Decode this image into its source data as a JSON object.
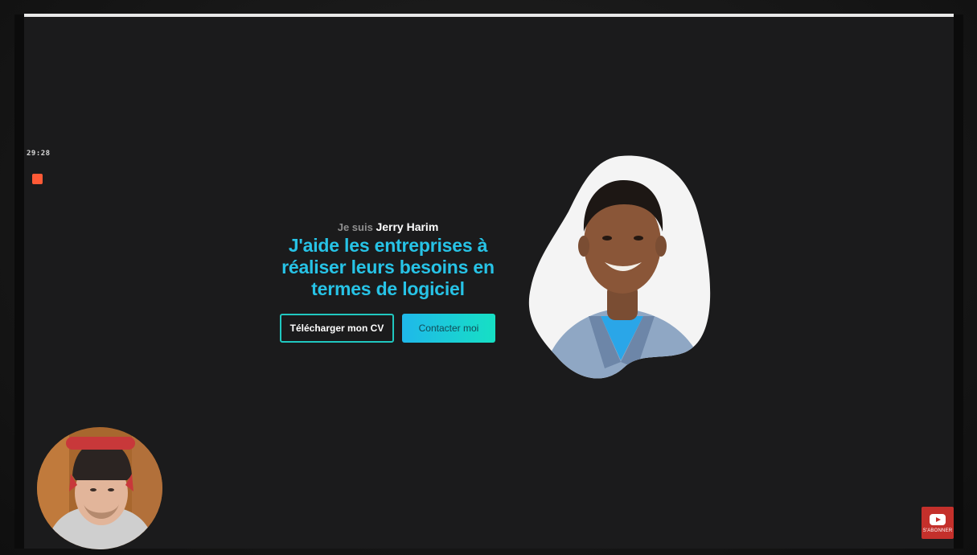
{
  "recording": {
    "timer": "29:28",
    "accent_color": "#ff5a36"
  },
  "hero": {
    "intro_prefix": "Je suis",
    "name": "Jerry Harim",
    "headline": "J'aide les entreprises à réaliser leurs besoins en termes de logiciel",
    "headline_color": "#27c3e6",
    "download_cv_label": "Télécharger mon CV",
    "contact_label": "Contacter moi"
  },
  "portrait": {
    "icon": "person-photo-blob"
  },
  "webcam": {
    "icon": "presenter-webcam-circle"
  },
  "subscribe_badge": {
    "icon": "youtube-play-icon",
    "label": "S'ABONNER",
    "color": "#c4302b"
  }
}
